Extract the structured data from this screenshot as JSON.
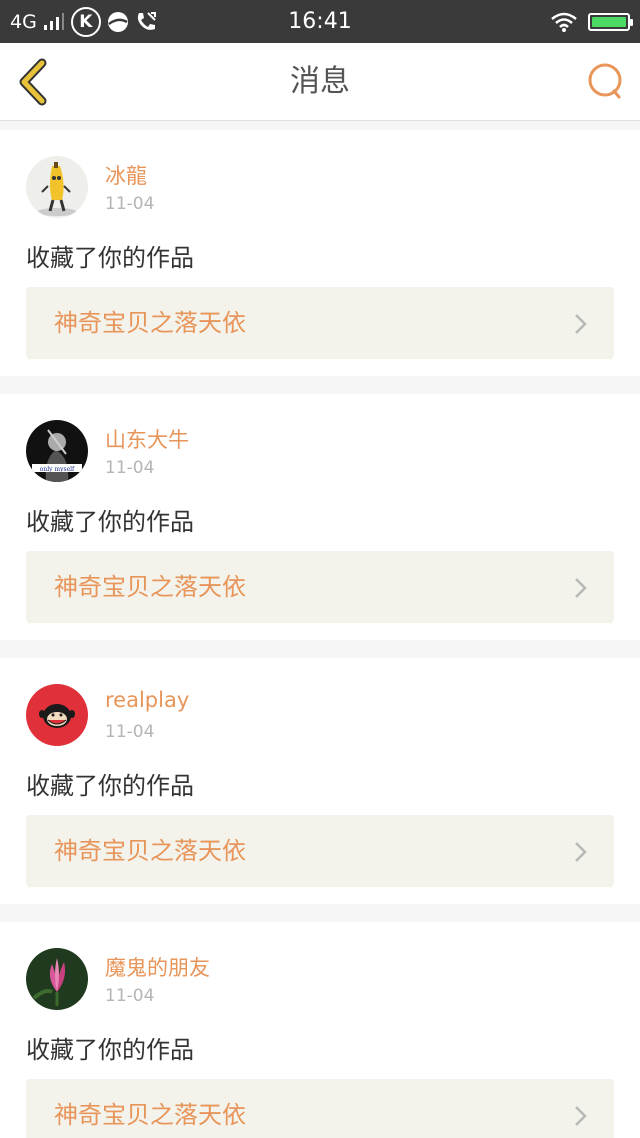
{
  "status_bar": {
    "network": "4G",
    "k_badge": "K",
    "time": "16:41"
  },
  "header": {
    "title": "消息",
    "back_icon": "chevron-left-icon",
    "search_icon": "search-icon"
  },
  "colors": {
    "accent": "#e8955a",
    "back_arrow": "#e8c33a",
    "link_bg": "#f3f3ec"
  },
  "messages": [
    {
      "username": "冰龍",
      "date": "11-04",
      "action": "收藏了你的作品",
      "work_title": "神奇宝贝之落天依"
    },
    {
      "username": "山东大牛",
      "date": "11-04",
      "action": "收藏了你的作品",
      "work_title": "神奇宝贝之落天依",
      "avatar_caption": "only myself"
    },
    {
      "username": "realplay",
      "date": "11-04",
      "action": "收藏了你的作品",
      "work_title": "神奇宝贝之落天依"
    },
    {
      "username": "魔鬼的朋友",
      "date": "11-04",
      "action": "收藏了你的作品",
      "work_title": "神奇宝贝之落天依"
    }
  ]
}
